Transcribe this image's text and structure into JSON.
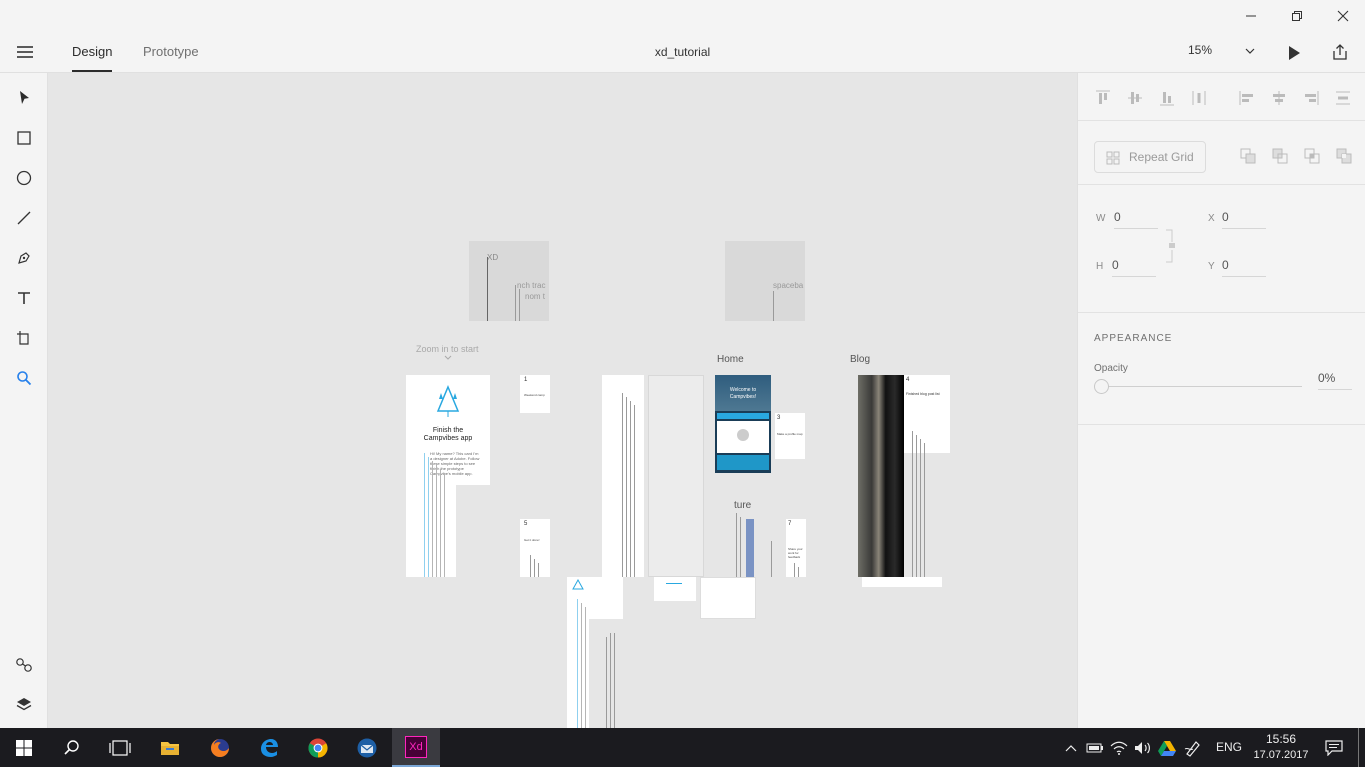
{
  "window": {
    "title": "xd_tutorial",
    "controls": [
      "minimize-icon",
      "restore-icon",
      "close-icon"
    ]
  },
  "header": {
    "tabs": [
      {
        "label": "Design",
        "active": true
      },
      {
        "label": "Prototype",
        "active": false
      }
    ],
    "zoom": "15%"
  },
  "toolbar": {
    "tools": [
      "select-icon",
      "rectangle-icon",
      "ellipse-icon",
      "line-icon",
      "pen-icon",
      "text-icon",
      "artboard-icon",
      "zoom-icon"
    ],
    "bottom": [
      "assets-icon",
      "layers-icon"
    ]
  },
  "canvas": {
    "zoom_hint": "Zoom in to start",
    "artboards": {
      "xd": "XD",
      "punch": "nch trac",
      "punch2": "nom t",
      "spacebar": "spaceba",
      "home_label": "Home",
      "blog_label": "Blog",
      "intro_title": "Finish the Campvibes app",
      "intro_body": "Hi! My name? This card I'm a designer at Adobe. Follow these simple steps to see finish the prototype Campvibe's mobile app.",
      "step1": "1",
      "step1_title": "Weekend camp",
      "home_welcome": "Welcome to Campvibes!",
      "step3": "3",
      "step3_title": "Make a profile map",
      "step4": "4",
      "step4_title": "Finished blog post list",
      "step5": "5",
      "step5_title": "Get it done!",
      "texture_label": "ture",
      "step7": "7",
      "step7_title": "Share your work for feedback"
    }
  },
  "panel": {
    "repeat_grid": "Repeat Grid",
    "w_label": "W",
    "w_value": "0",
    "h_label": "H",
    "h_value": "0",
    "x_label": "X",
    "x_value": "0",
    "y_label": "Y",
    "y_value": "0",
    "appearance": "APPEARANCE",
    "opacity_label": "Opacity",
    "opacity_value": "0%",
    "opacity_level": 0
  },
  "taskbar": {
    "apps": [
      "windows-start-icon",
      "search-icon",
      "task-view-icon",
      "file-explorer-icon",
      "firefox-icon",
      "edge-icon",
      "chrome-icon",
      "thunderbird-icon",
      "adobe-xd-icon"
    ],
    "xd_label": "Xd",
    "language": "ENG",
    "time": "15:56",
    "date": "17.07.2017"
  },
  "colors": {
    "accent": "#2680eb",
    "xd_brand": "#ff26be",
    "xd_bg": "#470137",
    "taskbar": "#1b1b1f"
  }
}
